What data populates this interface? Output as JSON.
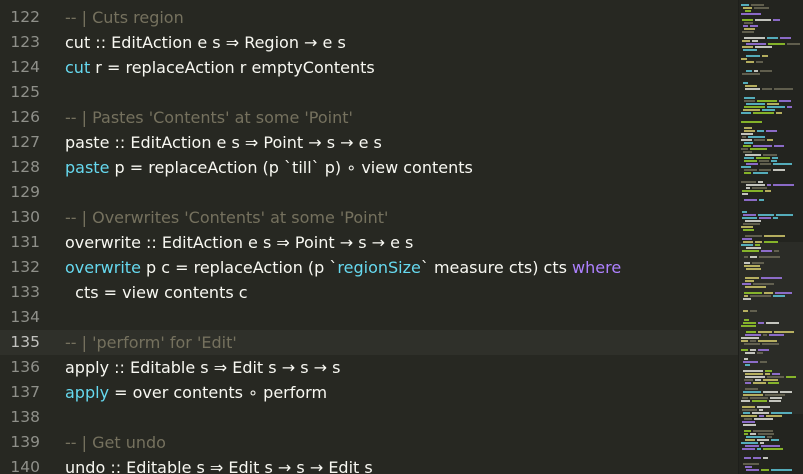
{
  "editor": {
    "active_line": 135,
    "lines": [
      {
        "num": "122",
        "tokens": [
          {
            "t": "-- | Cuts region",
            "c": "c"
          }
        ]
      },
      {
        "num": "123",
        "tokens": [
          {
            "t": "cut :: EditAction e s ⇒ Region → e s",
            "c": ""
          }
        ]
      },
      {
        "num": "124",
        "tokens": [
          {
            "t": "cut",
            "c": "f"
          },
          {
            "t": " r = replaceAction r emptyContents",
            "c": ""
          }
        ]
      },
      {
        "num": "125",
        "tokens": []
      },
      {
        "num": "126",
        "tokens": [
          {
            "t": "-- | Pastes 'Contents' at some 'Point'",
            "c": "c"
          }
        ]
      },
      {
        "num": "127",
        "tokens": [
          {
            "t": "paste :: EditAction e s ⇒ Point → s → e s",
            "c": ""
          }
        ]
      },
      {
        "num": "128",
        "tokens": [
          {
            "t": "paste",
            "c": "f"
          },
          {
            "t": " p = replaceAction (p `till` p) ∘ view contents",
            "c": ""
          }
        ]
      },
      {
        "num": "129",
        "tokens": []
      },
      {
        "num": "130",
        "tokens": [
          {
            "t": "-- | Overwrites 'Contents' at some 'Point'",
            "c": "c"
          }
        ]
      },
      {
        "num": "131",
        "tokens": [
          {
            "t": "overwrite :: EditAction e s ⇒ Point → s → e s",
            "c": ""
          }
        ]
      },
      {
        "num": "132",
        "tokens": [
          {
            "t": "overwrite",
            "c": "f"
          },
          {
            "t": " p c = replaceAction (p `",
            "c": ""
          },
          {
            "t": "regionSize",
            "c": "f"
          },
          {
            "t": "` measure cts) cts ",
            "c": ""
          },
          {
            "t": "where",
            "c": "k"
          }
        ]
      },
      {
        "num": "133",
        "tokens": [
          {
            "t": "  cts = view contents c",
            "c": ""
          }
        ]
      },
      {
        "num": "134",
        "tokens": []
      },
      {
        "num": "135",
        "tokens": [
          {
            "t": "-- | 'perform' for 'Edit'",
            "c": "c"
          }
        ]
      },
      {
        "num": "136",
        "tokens": [
          {
            "t": "apply :: Editable s ⇒ Edit s → s → s",
            "c": ""
          }
        ]
      },
      {
        "num": "137",
        "tokens": [
          {
            "t": "apply",
            "c": "f"
          },
          {
            "t": " = over contents ∘ perform",
            "c": ""
          }
        ]
      },
      {
        "num": "138",
        "tokens": []
      },
      {
        "num": "139",
        "tokens": [
          {
            "t": "-- | Get undo",
            "c": "c"
          }
        ]
      },
      {
        "num": "140",
        "tokens": [
          {
            "t": "undo :: Editable s ⇒ Edit s → s → Edit s",
            "c": ""
          }
        ]
      }
    ]
  },
  "colors": {
    "background": "#272822",
    "comment": "#75715e",
    "function": "#66d9ef",
    "keyword": "#ae81ff",
    "text": "#f8f8f2",
    "line_number": "#8f908a"
  }
}
